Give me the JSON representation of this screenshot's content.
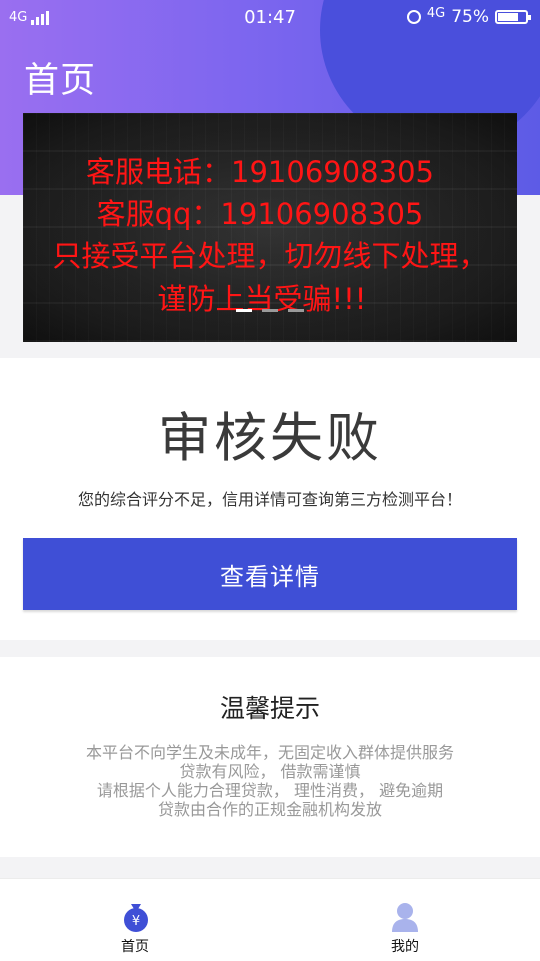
{
  "status_bar": {
    "network_left": "4G",
    "time": "01:47",
    "network_right": "4G",
    "battery": "75%"
  },
  "header": {
    "title": "首页"
  },
  "banner": {
    "lines": [
      "客服电话：19106908305",
      "客服qq：19106908305",
      "只接受平台处理，切勿线下处理，",
      "谨防上当受骗!!!"
    ],
    "slide_count": 3,
    "active_slide": 0
  },
  "result": {
    "title": "审核失败",
    "description": "您的综合评分不足，信用详情可查询第三方检测平台！",
    "button_label": "查看详情"
  },
  "tips": {
    "title": "温馨提示",
    "lines": [
      "本平台不向学生及未成年，无固定收入群体提供服务",
      "贷款有风险， 借款需谨慎",
      "请根据个人能力合理贷款， 理性消费， 避免逾期",
      "贷款由合作的正规金融机构发放"
    ]
  },
  "bottom_nav": {
    "items": [
      {
        "label": "首页",
        "icon": "money-bag-icon",
        "active": true
      },
      {
        "label": "我的",
        "icon": "user-icon",
        "active": false
      }
    ]
  },
  "colors": {
    "primary": "#3f4fd6",
    "header_gradient_start": "#9a6ff0",
    "header_gradient_end": "#5d5be6",
    "banner_text": "#ff1515"
  }
}
